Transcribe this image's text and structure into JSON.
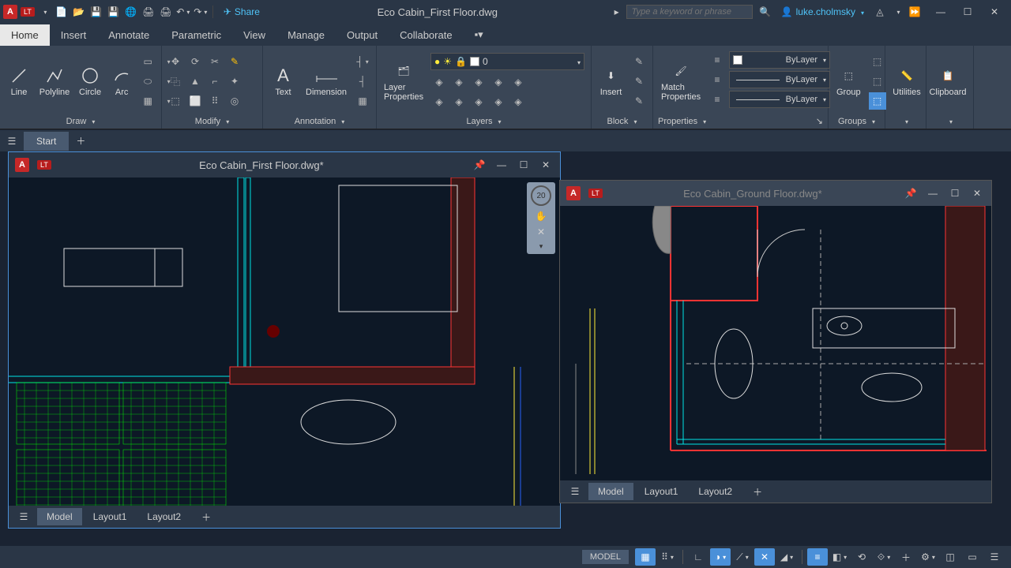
{
  "titlebar": {
    "app_letter": "A",
    "lt": "LT",
    "share": "Share",
    "title": "Eco Cabin_First Floor.dwg",
    "search_placeholder": "Type a keyword or phrase",
    "user": "luke.cholmsky"
  },
  "menu": {
    "tabs": [
      "Home",
      "Insert",
      "Annotate",
      "Parametric",
      "View",
      "Manage",
      "Output",
      "Collaborate"
    ]
  },
  "ribbon": {
    "draw": {
      "title": "Draw",
      "line": "Line",
      "polyline": "Polyline",
      "circle": "Circle",
      "arc": "Arc"
    },
    "modify": {
      "title": "Modify"
    },
    "annotation": {
      "title": "Annotation",
      "text": "Text",
      "dimension": "Dimension"
    },
    "layers": {
      "title": "Layers",
      "props": "Layer\nProperties",
      "current": "0"
    },
    "block": {
      "title": "Block",
      "insert": "Insert"
    },
    "properties": {
      "title": "Properties",
      "match": "Match\nProperties",
      "bylayer": "ByLayer"
    },
    "groups": {
      "title": "Groups",
      "group": "Group"
    },
    "utilities": {
      "title": "Utilities"
    },
    "clipboard": {
      "title": "Clipboard"
    }
  },
  "doctabs": {
    "start": "Start"
  },
  "window1": {
    "title": "Eco Cabin_First Floor.dwg*",
    "lt": "LT",
    "tabs": [
      "Model",
      "Layout1",
      "Layout2"
    ]
  },
  "window2": {
    "title": "Eco Cabin_Ground Floor.dwg*",
    "lt": "LT",
    "tabs": [
      "Model",
      "Layout1",
      "Layout2"
    ]
  },
  "status": {
    "model": "MODEL"
  }
}
